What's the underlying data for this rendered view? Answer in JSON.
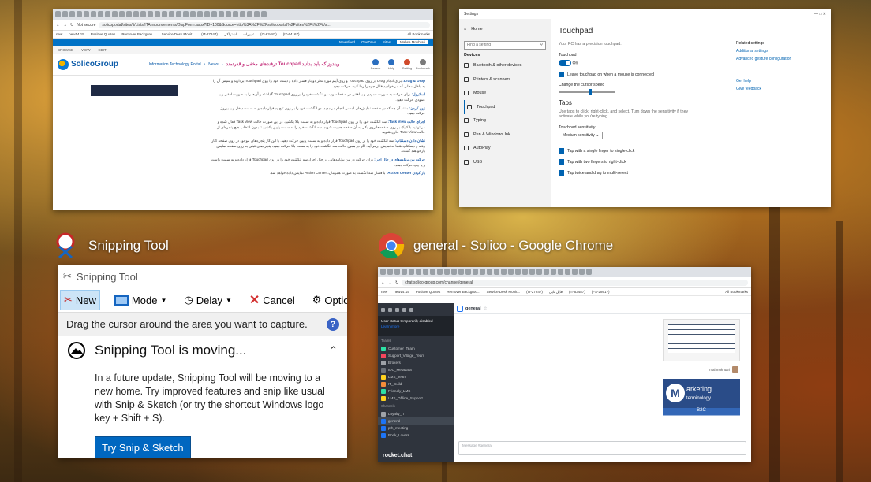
{
  "windows": {
    "sharepoint": {
      "url": "solicoportal/sites/it/Lists/ITAnnouncements/DispForm.aspx?ID=100&Source=http%3A%2F%2Fsolicoportal%2Fsites%2Fit%2Fit/s...",
      "not_secure": "Not secure",
      "bookmarks": [
        "new",
        "new14.15",
        "Positive Quotes",
        "Remover Backgrou...",
        "Service Desk Monit...",
        "(IT-27247)",
        "اشتراکی",
        "تغییرات",
        "(IT-63487)",
        "(IT-64167)",
        "All Bookmarks"
      ],
      "suite": {
        "newsfeed": "Newsfeed",
        "onedrive": "OneDrive",
        "sites": "Sites",
        "user": "Mahsa Mokhtari"
      },
      "ribbon": [
        "BROWSE",
        "VIEW",
        "EDIT"
      ],
      "logo": "SolicoGroup",
      "crumbs": [
        "Information Technology Portal",
        "News"
      ],
      "page_title": "ترفندهای مخفی و قدرتمند Touchpad ویندوز که باید بدانید",
      "tools": [
        "Search",
        "Help",
        "Setting",
        "Bookmark"
      ],
      "paragraphs": [
        {
          "bold": "Drag & Drop:",
          "text": "برای انجام Drag در روی Touchpad و روی آیتم مورد نظر دو بار فشار داده و دست خود را روی Touchpad بردارید و سپس آن را به داخل محلی که می‌خواهید قابل جوه را رها کنید، حرکت دهید."
        },
        {
          "bold": "اسکرول:",
          "text": "برای حرکت به صورت عمودی و یا افقی در صفحات وب دو انگشت خود را بر روی Touchpad گذاشته و آن‌ها را به صورت افقی و یا عمودی حرکت دهید."
        },
        {
          "bold": "زوم کردن:",
          "text": "مانند آن چه که در صفحه نمایش‌های لمسی انجام می‌دهید، دو انگشت خود را بر روی تاچ پد قرار داده و به سمت داخل و یا بیرون حرکت دهید."
        },
        {
          "bold": "اجرای حالت Task View:",
          "text": "سه انگشت خود را بر روی Touchpad قرار داده و به سمت بالا بکشید. در این صورت حالت Task View فعال شده و می‌توانید با کلیک بر روی صفحه‌ها روی یکی به آن صفحه هدایت شوید. سه انگشت خود را به سمت پایین بکشید تا بدون انتخاب هیچ پنجره‌ای از حالت Task View خارج شوید."
        },
        {
          "bold": "نشان دادن دسکتاپ:",
          "text": "سه انگشت خود را بر روی Touchpad قرار داده و به سمت پایین حرکت دهید. با این کار پنجره‌های موجود در روی صفحه کنار رفته و دسکتاپ شما به نمایش درمی‌آید. اگر در همین حالت سه انگشت خود را به سمت بالا حرکت دهید، پنجره‌های قبلی به روی صفحه نمایش بازخواهند گشت."
        },
        {
          "bold": "حرکت بین برنامه‌های در حال اجرا:",
          "text": "برای حرکت در بین برنامه‌هایی در حال اجرا، سه انگشت خود را بر روی Touchpad قرار داده و به سمت راست و یا چپ حرکت دهید."
        },
        {
          "bold": "باز کردن Action Center:",
          "text": "با فشار سه انگشت به صورت همزمان، Action Center نمایش داده خواهد شد."
        }
      ]
    },
    "settings": {
      "app_title": "Settings",
      "home": "Home",
      "search_placeholder": "Find a setting",
      "section": "Devices",
      "nav": [
        "Bluetooth & other devices",
        "Printers & scanners",
        "Mouse",
        "Touchpad",
        "Typing",
        "Pen & Windows Ink",
        "AutoPlay",
        "USB"
      ],
      "active_nav": "Touchpad",
      "heading": "Touchpad",
      "precision": "Your PC has a precision touchpad.",
      "toggle_label": "Touchpad",
      "toggle_state": "On",
      "leave_on": "Leave touchpad on when a mouse is connected",
      "speed_label": "Change the cursor speed",
      "speed_level": 0.55,
      "taps_heading": "Taps",
      "taps_desc": "Use taps to click, right-click, and select. Turn down the sensitivity if they activate while you're typing.",
      "sensitivity_label": "Touchpad sensitivity",
      "sensitivity_value": "Medium sensitivity",
      "tap_options": [
        "Tap with a single finger to single-click",
        "Tap with two fingers to right-click",
        "Tap twice and drag to multi-select"
      ],
      "related_title": "Related settings",
      "related_links": [
        "Additional settings",
        "Advanced gesture configuration"
      ],
      "help_links": [
        "Get help",
        "Give feedback"
      ]
    },
    "snipping": {
      "caption": "Snipping Tool",
      "title": "Snipping Tool",
      "toolbar": {
        "new": "New",
        "mode": "Mode",
        "delay": "Delay",
        "cancel": "Cancel",
        "options": "Options"
      },
      "hint": "Drag the cursor around the area you want to capture.",
      "notice_title": "Snipping Tool is moving...",
      "notice_body": "In a future update, Snipping Tool will be moving to a new home. Try improved features and snip like usual with Snip & Sketch (or try the shortcut Windows logo key + Shift + S).",
      "button": "Try Snip & Sketch"
    },
    "chrome": {
      "caption": "general - Solico - Google Chrome",
      "url": "chat.solico-group.com/channel/general",
      "bookmarks": [
        "new",
        "new14.15",
        "Positive Quotes",
        "Remover Backgrou...",
        "Service Desk Monit...",
        "(IT-27247)",
        "فایل تایی",
        "(IT-63487)",
        "(FS-2861?)",
        "All Bookmarks"
      ],
      "status_title": "User status temporarily disabled",
      "status_link": "Learn more",
      "teams_label": "Teams",
      "teams": [
        "Customer_Team",
        "Support_Village_Team",
        "Brokers",
        "IDC_Metadata",
        "LMS_Team",
        "IT_Guild",
        "Friendly_LMS",
        "LMS_Offline_Support"
      ],
      "channels_label": "Channels",
      "channels": [
        "Loyalty_IT",
        "general",
        "pth_meeting",
        "Book_Lovers"
      ],
      "active_channel": "general",
      "brand": "rocket.chat",
      "room": "general",
      "sender": "mal.mokhtari",
      "marketing_word": "arketing",
      "marketing_sub": "terminology",
      "marketing_tag": "B2C",
      "composer_placeholder": "Message #general"
    }
  },
  "colors": {
    "accent": "#0063b1",
    "sp_blue": "#0072c6",
    "sp_title": "#c4307b",
    "rc_side": "#2f343d",
    "snip_button": "#0067c0"
  }
}
